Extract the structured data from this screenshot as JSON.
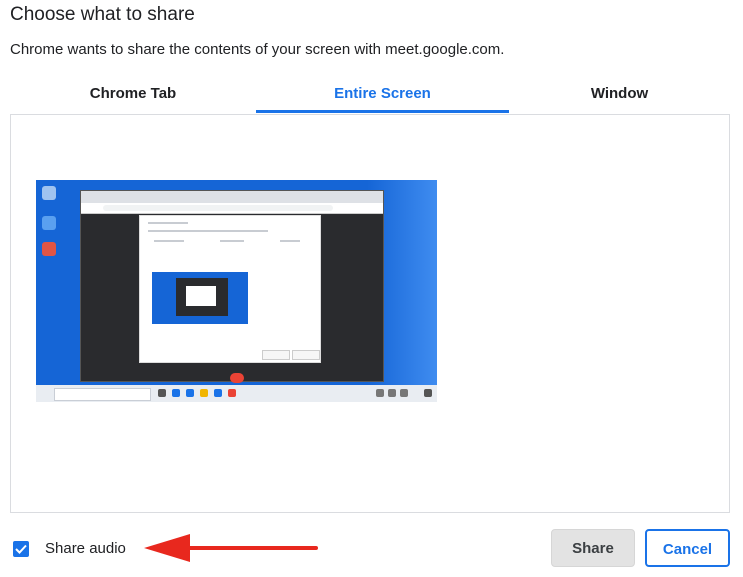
{
  "dialog": {
    "title": "Choose what to share",
    "subtitle": "Chrome wants to share the contents of your screen with meet.google.com."
  },
  "tabs": [
    {
      "label": "Chrome Tab",
      "active": false
    },
    {
      "label": "Entire Screen",
      "active": true
    },
    {
      "label": "Window",
      "active": false
    }
  ],
  "preview": {
    "icon": "screen-preview-thumbnail"
  },
  "share_audio": {
    "label": "Share audio",
    "checked": true
  },
  "annotation": {
    "icon": "red-arrow-icon",
    "color": "#e8281e"
  },
  "buttons": {
    "share_label": "Share",
    "cancel_label": "Cancel"
  },
  "colors": {
    "accent": "#1a73e8",
    "disabled_button": "#e3e3e3",
    "wallpaper": "#1565d6"
  }
}
